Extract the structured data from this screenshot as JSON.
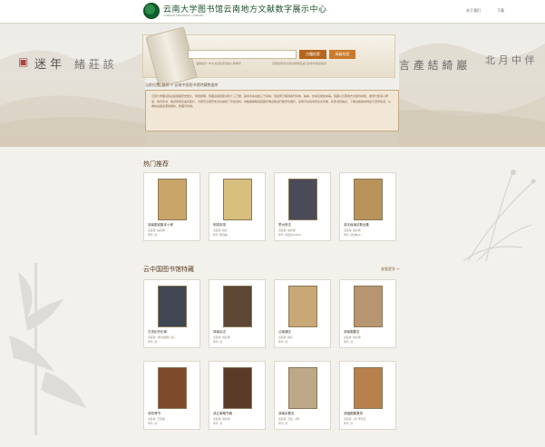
{
  "header": {
    "title": "云南大学图书馆云南地方文献数字展示中心",
    "subtitle": "YUNNAN UNIVERSITY LIBRARY",
    "links": [
      "关于我们",
      "下载"
    ]
  },
  "search": {
    "placeholder": "",
    "button_search": "古籍检索",
    "button_advanced": "高级检索",
    "hint_left": "温馨提示: 中文书名检索请输入繁体字",
    "hint_right": "高级检索请点击右侧按钮进行多条件组合检索"
  },
  "breadcrumb": "当前位置: 首页 > 云南中国图书馆特藏数据库",
  "intro": "云南大学图书馆古籍收藏历史悠久，特色鲜明，现藏古籍线装书约十三万册，其中善本古籍三千余种，包括宋元明清各代刻本、稿本、抄本及批校本等。馆藏以云南地方文献为特色，收录大量滇人著述、地方志书、族谱家乘及金石拓片，为研究云南历史文化提供了珍贵资料。本数据库精选馆藏珍稀古籍进行数字化展示，读者可在线浏览全文影像，检索书目信息，了解古籍版本特征与流传情况，以推动古籍资源的保护、整理与利用。",
  "hot": {
    "title": "热门推荐",
    "cards": [
      {
        "title": "滇南图说集本十种",
        "meta1": "责任者: 佚名撰",
        "meta2": "年代: 清",
        "cover": "#c9a56a"
      },
      {
        "title": "明滇安录",
        "meta1": "责任者: 佚名",
        "meta2": "年代: 明刻本",
        "cover": "#d8bf7e"
      },
      {
        "title": "思州府志",
        "meta1": "责任者: 佚名撰",
        "meta2": "年代: 清道光(1825)",
        "cover": "#4a4a58"
      },
      {
        "title": "滇天缘演法数全集",
        "meta1": "责任者: 佚名撰",
        "meta2": "年代: 清刻本(1)",
        "cover": "#b8935a"
      }
    ]
  },
  "special": {
    "title": "云中国图书馆特藏",
    "more": "查看更多 >",
    "cards_row1": [
      {
        "title": "古滇纪史纪事",
        "meta1": "责任者: (明)倪蜕辑 (清)...",
        "meta2": "年代: 清",
        "cover": "#3f4752"
      },
      {
        "title": "滇南杂志",
        "meta1": "责任者: 佚名撰",
        "meta2": "年代: 清",
        "cover": "#5b4733"
      },
      {
        "title": "云南通志",
        "meta1": "责任者: 佚名",
        "meta2": "年代: 清",
        "cover": "#c8a877"
      },
      {
        "title": "滇南图要志",
        "meta1": "责任者: 佚名撰",
        "meta2": "年代: 清",
        "cover": "#b89672"
      }
    ],
    "cards_row2": [
      {
        "title": "滇系簿书",
        "meta1": "责任者: 王宗福",
        "meta2": "年代: 清",
        "cover": "#7e4a2c"
      },
      {
        "title": "滇云事略书稿",
        "meta1": "责任者: 佚名撰",
        "meta2": "年代: 清",
        "cover": "#5a3a26"
      },
      {
        "title": "滇南杂要志",
        "meta1": "责任者: 王廷...(撰)",
        "meta2": "年代: 清",
        "cover": "#bda98a"
      },
      {
        "title": "滇缅图集要录",
        "meta1": "责任者: (清) 李培元",
        "meta2": "年代: 清",
        "cover": "#b8804b"
      }
    ]
  },
  "colors": {
    "accent": "#b5651d",
    "accent2": "#c97a2a",
    "intro_bg": "#f2e7d6"
  }
}
